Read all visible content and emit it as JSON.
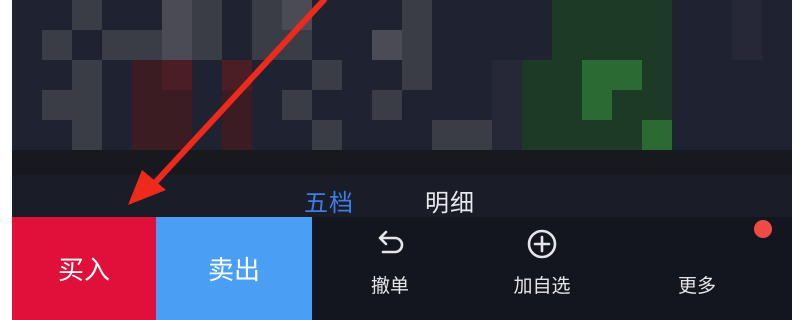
{
  "tabs": [
    {
      "label": "五档",
      "active": true
    },
    {
      "label": "明细",
      "active": false
    }
  ],
  "trade_buttons": {
    "buy_label": "买入",
    "sell_label": "卖出"
  },
  "tools": [
    {
      "label": "撤单",
      "icon": "undo-icon"
    },
    {
      "label": "加自选",
      "icon": "add-circle-icon"
    },
    {
      "label": "更多",
      "icon": "more-icon"
    }
  ],
  "colors": {
    "buy_bg": "#e0103a",
    "sell_bg": "#4a9ff5",
    "active_tab": "#3d7ee6",
    "inactive_tab": "#e8e8ee",
    "notification_dot": "#ef4b45",
    "annotation_arrow": "#ee2a1c"
  }
}
